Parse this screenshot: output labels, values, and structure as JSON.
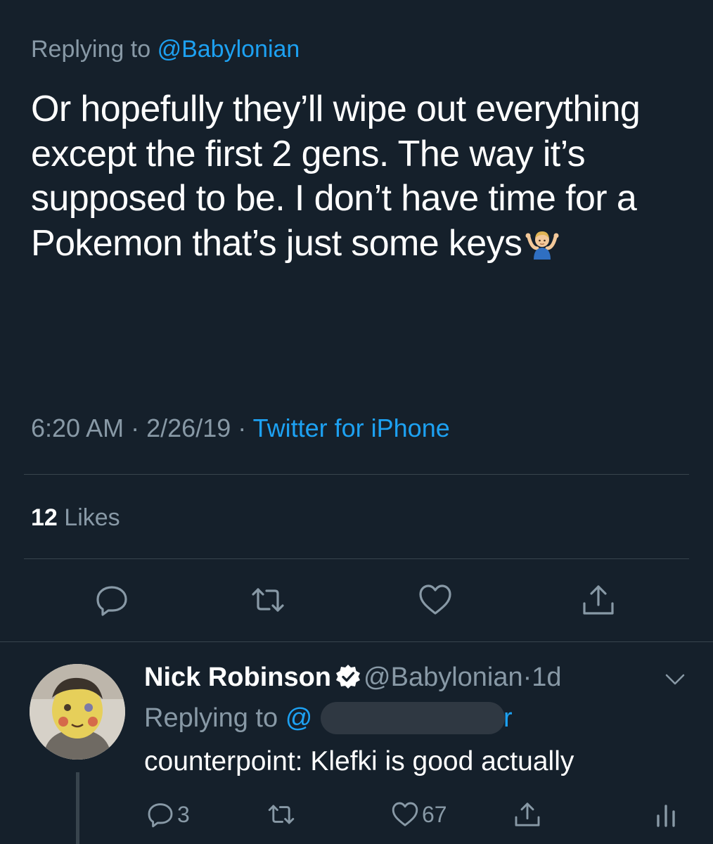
{
  "tweet": {
    "replying_prefix": "Replying to",
    "replying_handle": "@Babylonian",
    "text": "Or hopefully they’ll wipe out everything except the first 2 gens. The way it’s supposed to be. I don’t have time for a Pokemon that’s just some keys",
    "emoji_icon": "person-shrugging-emoji",
    "time": "6:20 AM",
    "date": "2/26/19",
    "separator": "·",
    "source": "Twitter for iPhone",
    "likes_count": "12",
    "likes_label": "Likes",
    "actions": [
      "reply-icon",
      "retweet-icon",
      "like-icon",
      "share-icon"
    ]
  },
  "reply": {
    "name": "Nick Robinson",
    "verified_icon": "verified-badge-icon",
    "handle": "@Babylonian",
    "dot": "·",
    "time": "1d",
    "replying_prefix": "Replying to",
    "replying_handle_start": "@",
    "replying_handle_end": "r",
    "text": "counterpoint: Klefki is good actually",
    "reply_count": "3",
    "like_count": "67",
    "actions": [
      "reply-icon",
      "retweet-icon",
      "like-icon",
      "share-icon",
      "analytics-icon"
    ]
  },
  "colors": {
    "background": "#15202b",
    "text": "#ffffff",
    "secondary_text": "#8899a6",
    "accent": "#1da1f2",
    "divider": "#38444d"
  }
}
